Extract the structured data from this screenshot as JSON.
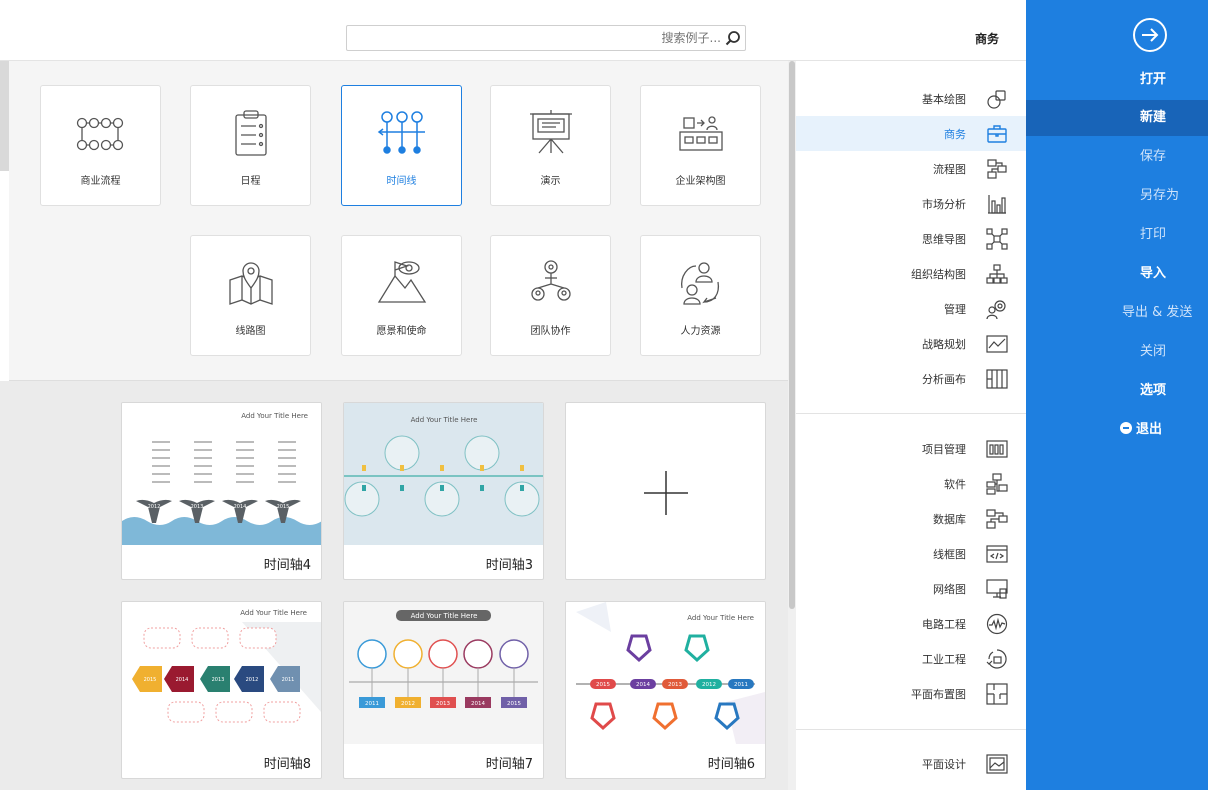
{
  "menu": {
    "items": [
      {
        "label": "打开",
        "state": "bold"
      },
      {
        "label": "新建",
        "state": "sel"
      },
      {
        "label": "保存",
        "state": "dim"
      },
      {
        "label": "另存为",
        "state": "dim"
      },
      {
        "label": "打印",
        "state": "dim"
      },
      {
        "label": "导入",
        "state": "bold"
      },
      {
        "label": "导出 & 发送",
        "state": "dim"
      },
      {
        "label": "关闭",
        "state": "dim"
      },
      {
        "label": "选项",
        "state": "bold"
      }
    ],
    "exit_label": "退出",
    "back_icon": "circle-arrow-right-icon",
    "accent": "#1e7fe0",
    "selected_bg": "#1864b8"
  },
  "search": {
    "placeholder": "搜索例子...",
    "icon": "search-icon"
  },
  "breadcrumb": "商务",
  "categories": [
    {
      "label": "基本绘图",
      "icon": "shapes-icon"
    },
    {
      "label": "商务",
      "icon": "briefcase-icon",
      "selected": true
    },
    {
      "label": "流程图",
      "icon": "flowchart-icon"
    },
    {
      "label": "市场分析",
      "icon": "bar-chart-icon"
    },
    {
      "label": "思维导图",
      "icon": "mindmap-icon"
    },
    {
      "label": "组织结构图",
      "icon": "org-chart-icon"
    },
    {
      "label": "管理",
      "icon": "gear-person-icon"
    },
    {
      "label": "战略规划",
      "icon": "strategy-icon"
    },
    {
      "label": "分析画布",
      "icon": "canvas-grid-icon"
    },
    {
      "label": "项目管理",
      "icon": "project-icon"
    },
    {
      "label": "软件",
      "icon": "software-icon"
    },
    {
      "label": "数据库",
      "icon": "database-icon"
    },
    {
      "label": "线框图",
      "icon": "wireframe-icon"
    },
    {
      "label": "网络图",
      "icon": "network-icon"
    },
    {
      "label": "电路工程",
      "icon": "circuit-icon"
    },
    {
      "label": "工业工程",
      "icon": "industrial-icon"
    },
    {
      "label": "平面布置图",
      "icon": "floorplan-icon"
    },
    {
      "label": "平面设计",
      "icon": "graphic-design-icon"
    }
  ],
  "subcategories": [
    {
      "label": "企业架构图",
      "icon": "enterprise-arch-icon"
    },
    {
      "label": "演示",
      "icon": "presentation-icon"
    },
    {
      "label": "时间线",
      "icon": "timeline-icon",
      "selected": true
    },
    {
      "label": "日程",
      "icon": "clipboard-icon"
    },
    {
      "label": "商业流程",
      "icon": "business-process-icon"
    },
    {
      "label": "人力资源",
      "icon": "hr-icon"
    },
    {
      "label": "团队协作",
      "icon": "team-icon"
    },
    {
      "label": "愿景和使命",
      "icon": "vision-icon"
    },
    {
      "label": "线路图",
      "icon": "map-pin-icon"
    }
  ],
  "templates": [
    {
      "name": "",
      "blank": true
    },
    {
      "name": "时间轴3"
    },
    {
      "name": "时间轴4"
    },
    {
      "name": "时间轴6"
    },
    {
      "name": "时间轴7"
    },
    {
      "name": "时间轴8"
    }
  ],
  "thumb_text": {
    "add_title": "Add Your Title Here",
    "years_t6": [
      "2015",
      "2014",
      "2013",
      "2012",
      "2011"
    ],
    "years_t7": [
      "2011",
      "2012",
      "2013",
      "2014",
      "2015"
    ],
    "years_t8": [
      "2011",
      "2012",
      "2013",
      "2014",
      "2015"
    ],
    "years_t4": [
      "2012",
      "2013",
      "2014",
      "2015"
    ]
  }
}
